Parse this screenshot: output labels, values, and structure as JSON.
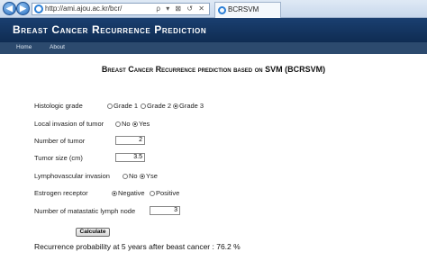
{
  "browser": {
    "url": "http://ami.ajou.ac.kr/bcr/",
    "url_tools": "ρ ▾ ⊠ ↺ ✕",
    "tab_title": "BCRSVM",
    "nav_back": "◀",
    "nav_forward": "▶"
  },
  "header": {
    "title": "Breast Cancer Recurrence Prediction"
  },
  "menu": {
    "items": [
      "Home",
      "About"
    ]
  },
  "page": {
    "title": "Breast Cancer Recurrence prediction based on SVM (BCRSVM)"
  },
  "form": {
    "histologic_grade": {
      "label": "Histologic grade",
      "options": [
        "Grade 1",
        "Grade 2",
        "Grade 3"
      ],
      "selected": "Grade 3"
    },
    "local_invasion": {
      "label": "Local invasion of tumor",
      "options": [
        "No",
        "Yes"
      ],
      "selected": "Yes"
    },
    "number_of_tumor": {
      "label": "Number of tumor",
      "value": "2"
    },
    "tumor_size": {
      "label": "Tumor size (cm)",
      "value": "3.5"
    },
    "lymphovascular": {
      "label": "Lymphovascular invasion",
      "options": [
        "No",
        "Yse"
      ],
      "selected": "Yse"
    },
    "estrogen_receptor": {
      "label": "Estrogen receptor",
      "options": [
        "Negative",
        "Positive"
      ],
      "selected": "Negative"
    },
    "lymph_nodes": {
      "label": "Number of matastatic lymph node",
      "value": "3"
    },
    "calculate_label": "Calculate"
  },
  "result": {
    "text": "Recurrence probability at 5 years after beast cancer : 76.2 %"
  },
  "colors": {
    "header_bg": "#13365f",
    "menu_bg": "#2c4a6e"
  }
}
